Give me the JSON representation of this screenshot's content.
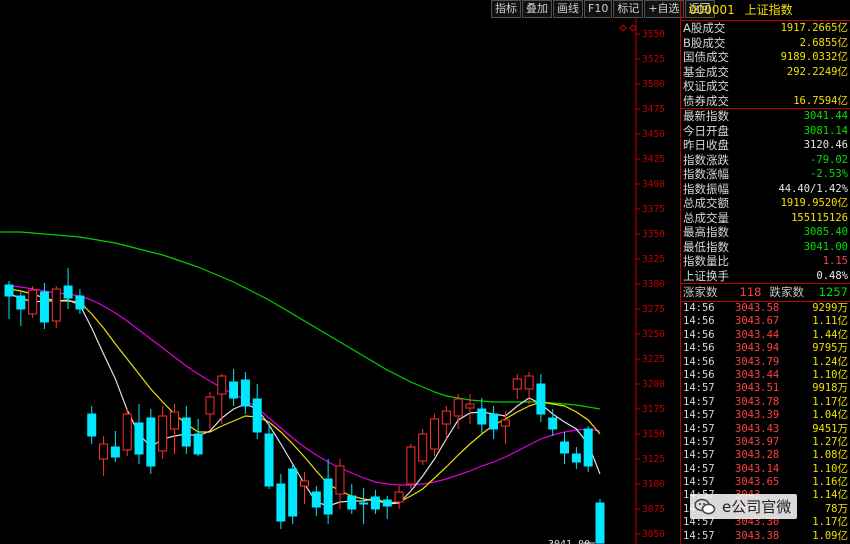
{
  "toolbar": [
    "指标",
    "叠加",
    "画线",
    "F10",
    "标记",
    "+自选",
    "返回"
  ],
  "panel": {
    "code": "000001",
    "name": "上证指数",
    "volume_rows": [
      {
        "label": "A股成交",
        "value": "1917.2665亿"
      },
      {
        "label": "B股成交",
        "value": "2.6855亿"
      },
      {
        "label": "国债成交",
        "value": "9189.0332亿"
      },
      {
        "label": "基金成交",
        "value": "292.2249亿"
      },
      {
        "label": "权证成交",
        "value": ""
      },
      {
        "label": "债券成交",
        "value": "16.7594亿"
      }
    ],
    "stat_rows": [
      {
        "label": "最新指数",
        "value": "3041.44",
        "color": "#00e000"
      },
      {
        "label": "今日开盘",
        "value": "3081.14",
        "color": "#00e000"
      },
      {
        "label": "昨日收盘",
        "value": "3120.46",
        "color": "#e8e8e8"
      },
      {
        "label": "指数涨跌",
        "value": "-79.02",
        "color": "#00e000"
      },
      {
        "label": "指数涨幅",
        "value": "-2.53%",
        "color": "#00e000"
      },
      {
        "label": "指数振幅",
        "value": "44.40/1.42%",
        "color": "#e8e8e8"
      },
      {
        "label": "总成交额",
        "value": "1919.9520亿",
        "color": "#f0e000"
      },
      {
        "label": "总成交量",
        "value": "155115126",
        "color": "#f0e000"
      },
      {
        "label": "最高指数",
        "value": "3085.40",
        "color": "#00e000"
      },
      {
        "label": "最低指数",
        "value": "3041.00",
        "color": "#00e000"
      },
      {
        "label": "指数量比",
        "value": "1.15",
        "color": "#ff4040"
      },
      {
        "label": "上证换手",
        "value": "0.48%",
        "color": "#e8e8e8"
      }
    ],
    "advance_label": "涨家数",
    "advance_value": "118",
    "decline_label": "跌家数",
    "decline_value": "1257",
    "ticks": [
      {
        "time": "14:56",
        "price": "3043.58",
        "vol": "9299万"
      },
      {
        "time": "14:56",
        "price": "3043.67",
        "vol": "1.11亿"
      },
      {
        "time": "14:56",
        "price": "3043.44",
        "vol": "1.44亿"
      },
      {
        "time": "14:56",
        "price": "3043.94",
        "vol": "9795万"
      },
      {
        "time": "14:56",
        "price": "3043.79",
        "vol": "1.24亿"
      },
      {
        "time": "14:56",
        "price": "3043.44",
        "vol": "1.10亿"
      },
      {
        "time": "14:57",
        "price": "3043.51",
        "vol": "9918万"
      },
      {
        "time": "14:57",
        "price": "3043.78",
        "vol": "1.17亿"
      },
      {
        "time": "14:57",
        "price": "3043.39",
        "vol": "1.04亿"
      },
      {
        "time": "14:57",
        "price": "3043.43",
        "vol": "9451万"
      },
      {
        "time": "14:57",
        "price": "3043.97",
        "vol": "1.27亿"
      },
      {
        "time": "14:57",
        "price": "3043.28",
        "vol": "1.08亿"
      },
      {
        "time": "14:57",
        "price": "3043.14",
        "vol": "1.10亿"
      },
      {
        "time": "14:57",
        "price": "3043.65",
        "vol": "1.16亿"
      },
      {
        "time": "14:57",
        "price": "3043.",
        "vol": "1.14亿"
      },
      {
        "time": "14:57",
        "price": "3043.",
        "vol": "78万"
      },
      {
        "time": "14:57",
        "price": "3043.30",
        "vol": "1.17亿"
      },
      {
        "time": "14:57",
        "price": "3043.38",
        "vol": "1.09亿"
      }
    ]
  },
  "watermark": "e公司官微",
  "colors": {
    "up": "#ff3030",
    "down": "#00e8ff",
    "axis": "#c00000",
    "ma5": "#e0e0e0",
    "ma10": "#f0e000",
    "ma20": "#e000e0",
    "ma60": "#00d000"
  },
  "chart_data": {
    "type": "candlestick",
    "y_ticks": [
      3050,
      3075,
      3100,
      3125,
      3150,
      3175,
      3200,
      3225,
      3250,
      3275,
      3300,
      3325,
      3350,
      3375,
      3400,
      3425,
      3450,
      3475,
      3500,
      3525,
      3550
    ],
    "ylim": [
      3040,
      3570
    ],
    "last_price_label": "3041.00",
    "candles": [
      [
        3299,
        3303,
        3265,
        3288
      ],
      [
        3288,
        3292,
        3258,
        3275
      ],
      [
        3270,
        3298,
        3266,
        3294
      ],
      [
        3292,
        3301,
        3255,
        3262
      ],
      [
        3263,
        3298,
        3256,
        3295
      ],
      [
        3298,
        3316,
        3275,
        3286
      ],
      [
        3288,
        3295,
        3270,
        3275
      ],
      [
        3170,
        3178,
        3140,
        3148
      ],
      [
        3125,
        3148,
        3108,
        3140
      ],
      [
        3137,
        3153,
        3122,
        3127
      ],
      [
        3134,
        3175,
        3128,
        3170
      ],
      [
        3161,
        3180,
        3120,
        3130
      ],
      [
        3166,
        3175,
        3110,
        3118
      ],
      [
        3133,
        3178,
        3125,
        3168
      ],
      [
        3155,
        3180,
        3130,
        3172
      ],
      [
        3166,
        3178,
        3130,
        3138
      ],
      [
        3150,
        3165,
        3128,
        3130
      ],
      [
        3170,
        3192,
        3155,
        3187
      ],
      [
        3190,
        3210,
        3160,
        3208
      ],
      [
        3202,
        3215,
        3178,
        3186
      ],
      [
        3204,
        3212,
        3170,
        3178
      ],
      [
        3185,
        3200,
        3145,
        3152
      ],
      [
        3150,
        3160,
        3095,
        3098
      ],
      [
        3100,
        3110,
        3055,
        3063
      ],
      [
        3115,
        3120,
        3060,
        3068
      ],
      [
        3098,
        3112,
        3080,
        3103
      ],
      [
        3092,
        3098,
        3068,
        3077
      ],
      [
        3105,
        3125,
        3060,
        3070
      ],
      [
        3090,
        3125,
        3075,
        3118
      ],
      [
        3088,
        3100,
        3070,
        3075
      ],
      [
        3081,
        3096,
        3060,
        3080
      ],
      [
        3087,
        3094,
        3070,
        3075
      ],
      [
        3084,
        3088,
        3065,
        3078
      ],
      [
        3082,
        3098,
        3075,
        3092
      ],
      [
        3100,
        3140,
        3095,
        3137
      ],
      [
        3123,
        3155,
        3119,
        3150
      ],
      [
        3135,
        3170,
        3128,
        3165
      ],
      [
        3160,
        3178,
        3145,
        3173
      ],
      [
        3168,
        3190,
        3155,
        3185
      ],
      [
        3176,
        3190,
        3160,
        3180
      ],
      [
        3175,
        3186,
        3150,
        3160
      ],
      [
        3170,
        3178,
        3145,
        3155
      ],
      [
        3158,
        3172,
        3140,
        3164
      ],
      [
        3195,
        3210,
        3185,
        3205
      ],
      [
        3195,
        3212,
        3180,
        3208
      ],
      [
        3200,
        3210,
        3162,
        3170
      ],
      [
        3166,
        3175,
        3148,
        3155
      ],
      [
        3142,
        3152,
        3120,
        3131
      ],
      [
        3130,
        3137,
        3115,
        3122
      ],
      [
        3155,
        3158,
        3112,
        3118
      ],
      [
        3081,
        3085,
        3041,
        3041
      ]
    ],
    "ma60": [
      3352,
      3352,
      3351,
      3350,
      3349,
      3348,
      3347,
      3345,
      3343,
      3341,
      3338,
      3335,
      3332,
      3329,
      3325,
      3321,
      3317,
      3312,
      3307,
      3302,
      3296,
      3290,
      3284,
      3277,
      3270,
      3263,
      3256,
      3249,
      3242,
      3235,
      3228,
      3221,
      3214,
      3208,
      3202,
      3197,
      3192,
      3188,
      3186,
      3184,
      3183,
      3182,
      3182,
      3182,
      3182,
      3182,
      3181,
      3180,
      3179,
      3177,
      3175
    ],
    "ma20": [
      3298,
      3297,
      3295,
      3293,
      3291,
      3290,
      3288,
      3284,
      3278,
      3271,
      3263,
      3254,
      3245,
      3236,
      3227,
      3218,
      3210,
      3203,
      3196,
      3190,
      3184,
      3176,
      3166,
      3156,
      3146,
      3137,
      3129,
      3122,
      3116,
      3111,
      3106,
      3102,
      3100,
      3099,
      3099,
      3100,
      3102,
      3105,
      3109,
      3113,
      3118,
      3122,
      3127,
      3133,
      3139,
      3145,
      3149,
      3152,
      3154,
      3155,
      3153
    ],
    "ma10": [
      3295,
      3293,
      3290,
      3286,
      3283,
      3283,
      3282,
      3270,
      3256,
      3240,
      3225,
      3210,
      3195,
      3182,
      3170,
      3160,
      3152,
      3152,
      3158,
      3163,
      3168,
      3167,
      3162,
      3152,
      3140,
      3127,
      3113,
      3100,
      3093,
      3088,
      3085,
      3083,
      3081,
      3082,
      3088,
      3095,
      3106,
      3117,
      3129,
      3140,
      3150,
      3159,
      3165,
      3172,
      3178,
      3182,
      3180,
      3178,
      3172,
      3164,
      3150
    ],
    "ma5": [
      3290,
      3286,
      3282,
      3283,
      3283,
      3284,
      3279,
      3256,
      3230,
      3205,
      3174,
      3150,
      3137,
      3145,
      3148,
      3150,
      3148,
      3153,
      3166,
      3175,
      3180,
      3175,
      3159,
      3140,
      3120,
      3100,
      3082,
      3078,
      3082,
      3083,
      3083,
      3086,
      3080,
      3081,
      3093,
      3108,
      3125,
      3145,
      3164,
      3171,
      3172,
      3170,
      3168,
      3178,
      3186,
      3180,
      3170,
      3162,
      3155,
      3140,
      3110
    ]
  }
}
